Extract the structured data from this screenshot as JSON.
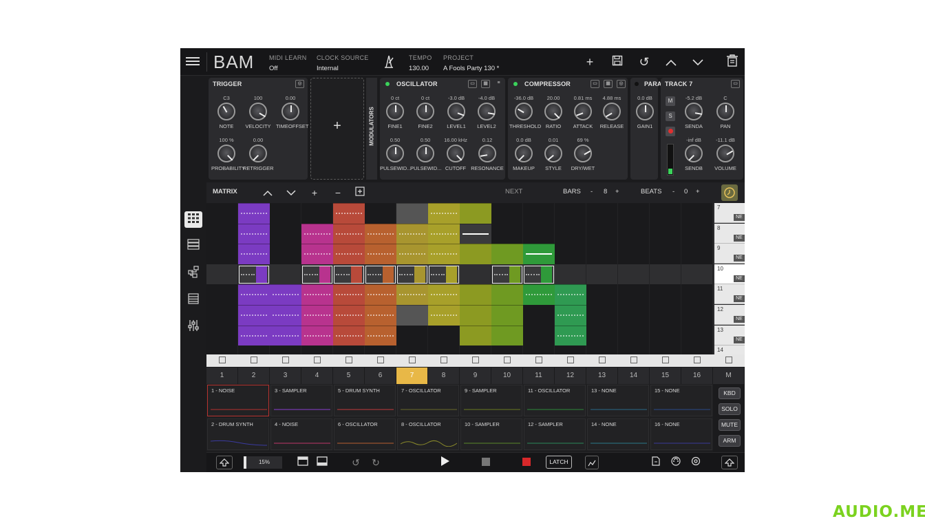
{
  "app": {
    "brand": "BAM"
  },
  "topbar": {
    "midi_learn_label": "MIDI LEARN",
    "midi_learn_value": "Off",
    "clock_source_label": "CLOCK SOURCE",
    "clock_source_value": "Internal",
    "tempo_label": "TEMPO",
    "tempo_value": "130.00",
    "project_label": "PROJECT",
    "project_value": "A Fools Party 130 *",
    "icons": [
      "menu-icon",
      "metronome-icon",
      "plus-icon",
      "save-icon",
      "undo-icon",
      "chevron-up-icon",
      "chevron-down-icon",
      "trash-icon"
    ]
  },
  "trigger": {
    "title": "TRIGGER",
    "knobs": [
      {
        "label": "NOTE",
        "value": "C3"
      },
      {
        "label": "VELOCITY",
        "value": "100"
      },
      {
        "label": "TIMEOFFSET",
        "value": "0.00"
      },
      {
        "label": "PROBABILITY",
        "value": "100 %"
      },
      {
        "label": "RETRIGGER",
        "value": "0.00"
      }
    ]
  },
  "add_device": {
    "label": "+"
  },
  "modulators_label": "MODULATORS",
  "oscillator": {
    "title": "OSCILLATOR",
    "knobs": [
      {
        "label": "FINE1",
        "value": "0 ct"
      },
      {
        "label": "FINE2",
        "value": "0 ct"
      },
      {
        "label": "LEVEL1",
        "value": "-3.0 dB"
      },
      {
        "label": "LEVEL2",
        "value": "-4.0 dB"
      },
      {
        "label": "PULSEWID...",
        "value": "0.50"
      },
      {
        "label": "PULSEWID...",
        "value": "0.50"
      },
      {
        "label": "CUTOFF",
        "value": "16.00 kHz"
      },
      {
        "label": "RESONANCE",
        "value": "0.12"
      }
    ]
  },
  "compressor": {
    "title": "COMPRESSOR",
    "knobs": [
      {
        "label": "THRESHOLD",
        "value": "-36.0 dB"
      },
      {
        "label": "RATIO",
        "value": "20.00"
      },
      {
        "label": "ATTACK",
        "value": "0.81 ms"
      },
      {
        "label": "RELEASE",
        "value": "4.88 ms"
      },
      {
        "label": "MAKEUP",
        "value": "0.0 dB"
      },
      {
        "label": "STYLE",
        "value": "0.01"
      },
      {
        "label": "DRY/WET",
        "value": "69 %"
      }
    ]
  },
  "para": {
    "title": "PARA",
    "knobs": [
      {
        "label": "GAIN1",
        "value": "0.0 dB"
      }
    ]
  },
  "track7": {
    "title": "TRACK 7",
    "m_label": "M",
    "s_label": "S",
    "knobs": [
      {
        "label": "SENDA",
        "value": "-5.2 dB"
      },
      {
        "label": "PAN",
        "value": "C"
      },
      {
        "label": "SENDB",
        "value": "-inf dB"
      },
      {
        "label": "VOLUME",
        "value": "-11.1 dB"
      }
    ]
  },
  "matrix": {
    "title": "MATRIX",
    "next_label": "NEXT",
    "bars_label": "BARS",
    "bars_minus": "-",
    "bars_value": "8",
    "bars_plus": "+",
    "beats_label": "BEATS",
    "beats_minus": "-",
    "beats_value": "0",
    "beats_plus": "+"
  },
  "scenes": [
    {
      "num": "7",
      "ne": "NE"
    },
    {
      "num": "8",
      "ne": "NE"
    },
    {
      "num": "9",
      "ne": "NE"
    },
    {
      "num": "10",
      "ne": "NE"
    },
    {
      "num": "11",
      "ne": "NE"
    },
    {
      "num": "12",
      "ne": "NE"
    },
    {
      "num": "13",
      "ne": "NE"
    },
    {
      "num": "14",
      "ne": ""
    }
  ],
  "track_numbers": [
    "1",
    "2",
    "3",
    "4",
    "5",
    "6",
    "7",
    "8",
    "9",
    "10",
    "11",
    "12",
    "13",
    "14",
    "15",
    "16",
    "M"
  ],
  "selected_track": "7",
  "tracks": [
    {
      "label": "1 - NOISE",
      "color": "#b8332f"
    },
    {
      "label": "3 - SAMPLER",
      "color": "#8a3fd1"
    },
    {
      "label": "5 - DRUM SYNTH",
      "color": "#c23b3b"
    },
    {
      "label": "7 - OSCILLATOR",
      "color": "#6a6a2a"
    },
    {
      "label": "9 - SAMPLER",
      "color": "#6b7a1f"
    },
    {
      "label": "11 - OSCILLATOR",
      "color": "#2f8a3a"
    },
    {
      "label": "13 - NONE",
      "color": "#2a6a8a"
    },
    {
      "label": "15 - NONE",
      "color": "#2a4a8a"
    },
    {
      "label": "2 - DRUM SYNTH",
      "color": "#3a3aa0"
    },
    {
      "label": "4 - NOISE",
      "color": "#c0356a"
    },
    {
      "label": "6 - OSCILLATOR",
      "color": "#b9602f"
    },
    {
      "label": "8 - OSCILLATOR",
      "color": "#8a8a2a"
    },
    {
      "label": "10 - SAMPLER",
      "color": "#5a8a2a"
    },
    {
      "label": "12 - SAMPLER",
      "color": "#2a8a5a"
    },
    {
      "label": "14 - NONE",
      "color": "#2a7a8a"
    },
    {
      "label": "16 - NONE",
      "color": "#3a3a9a"
    }
  ],
  "side_buttons": [
    "KBD",
    "SOLO",
    "MUTE",
    "ARM"
  ],
  "transport": {
    "cpu_value": "15%",
    "latch_label": "LATCH"
  },
  "clip_colors": [
    "#7b3bc2",
    "#7b3bc2",
    "#b8338e",
    "#b84a3a",
    "#b8612f",
    "#a8952f",
    "#a8a02a",
    "#8c9a22",
    "#6f9a22",
    "#2f9a3a",
    "#2f9a52"
  ],
  "watermark": "AUDIO.ME"
}
